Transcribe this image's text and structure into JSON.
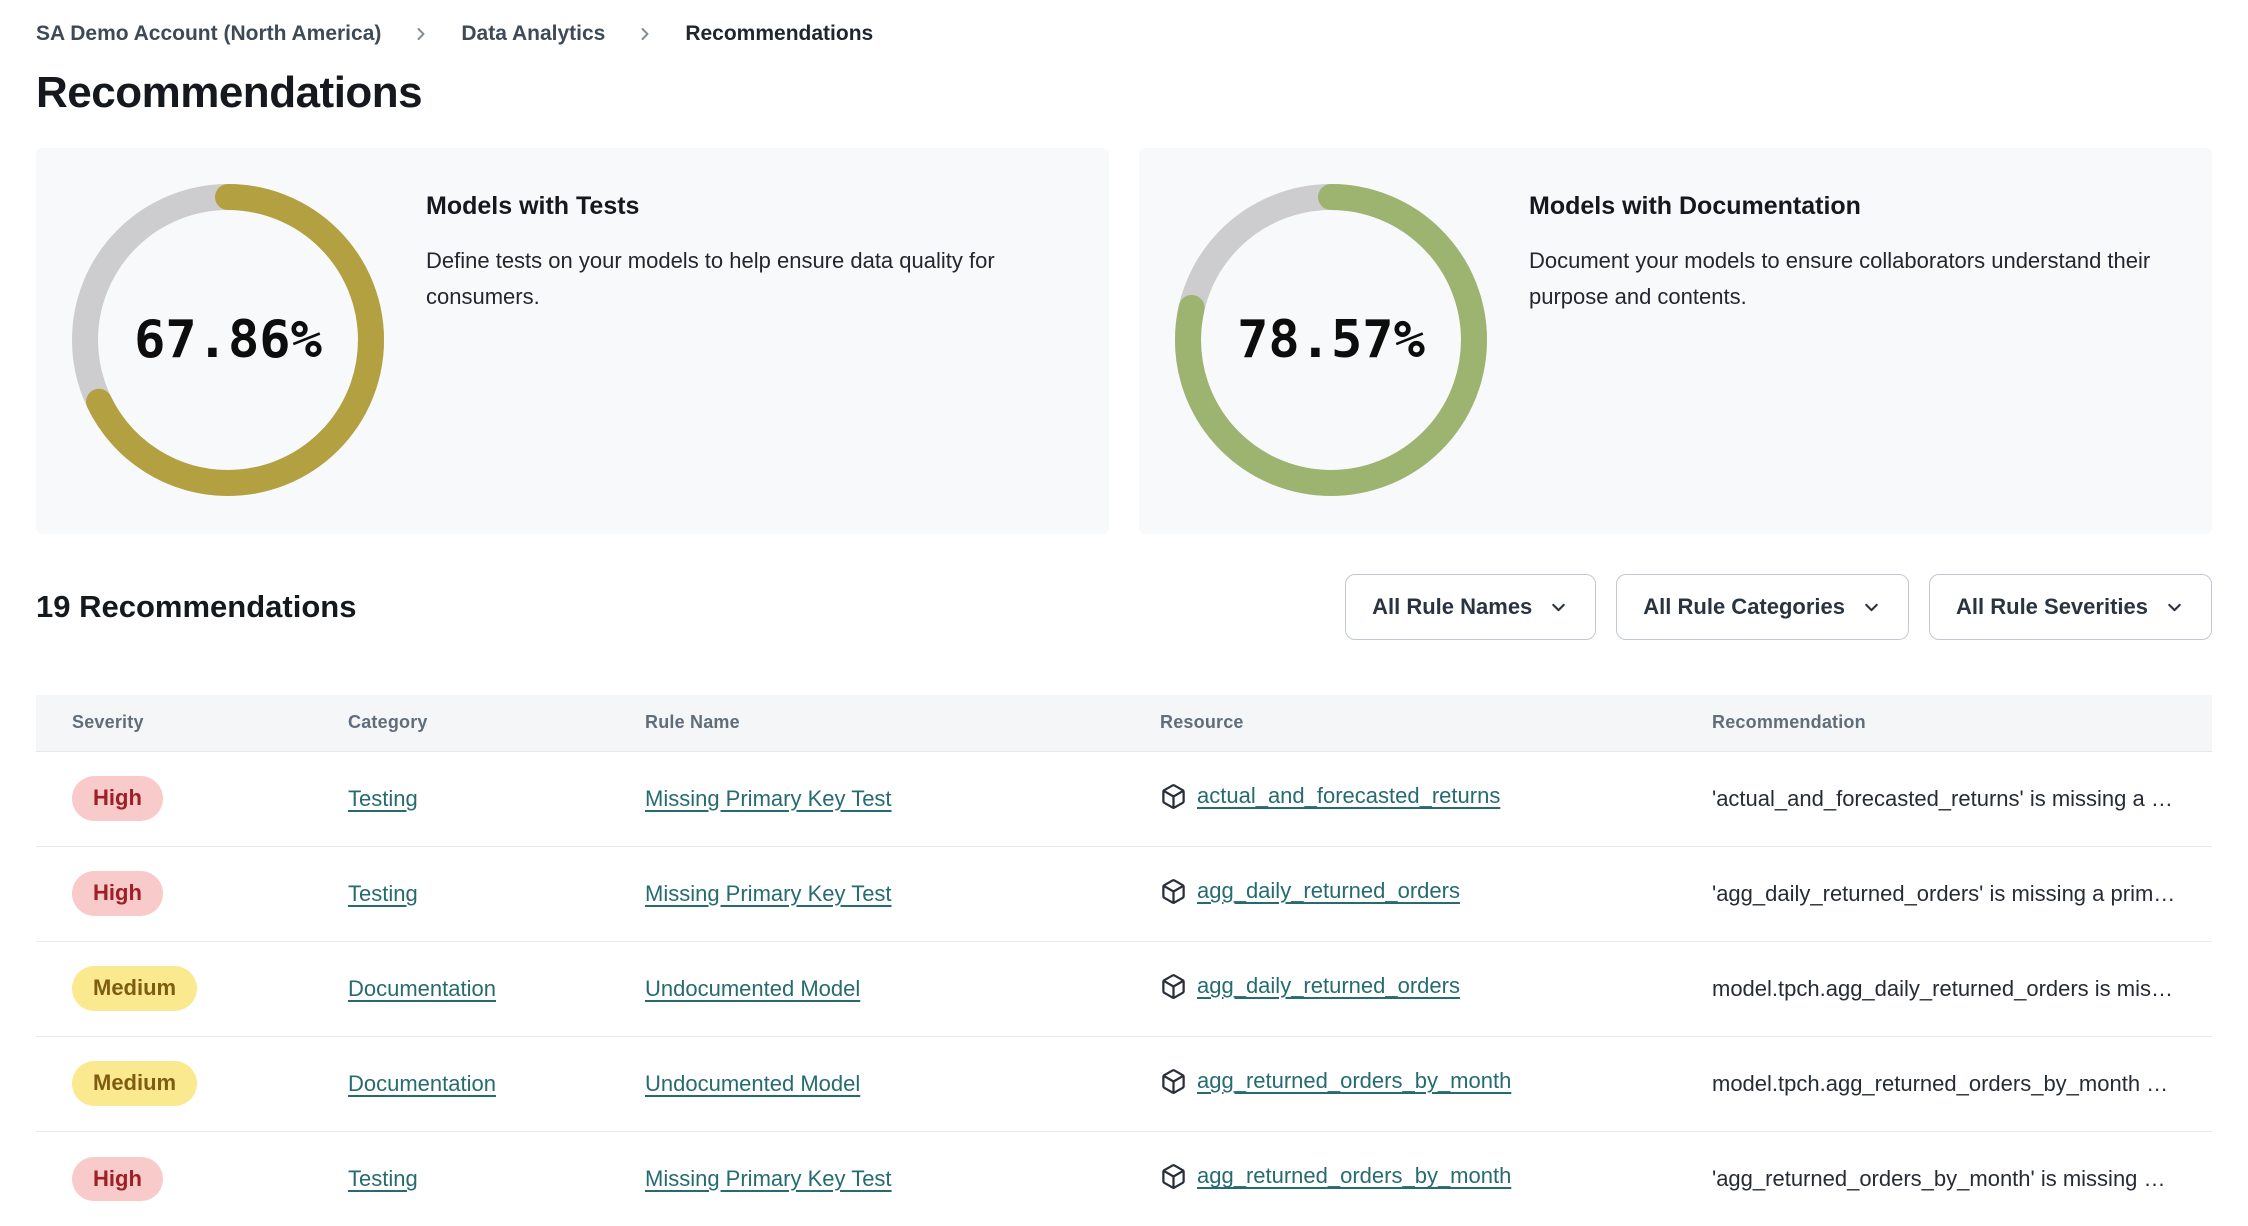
{
  "breadcrumb": {
    "items": [
      {
        "label": "SA Demo Account (North America)"
      },
      {
        "label": "Data Analytics"
      },
      {
        "label": "Recommendations"
      }
    ]
  },
  "page": {
    "title": "Recommendations"
  },
  "cards": [
    {
      "title": "Models with Tests",
      "description": "Define tests on your models to help ensure data quality for consumers.",
      "percent": 67.86,
      "percent_label": "67.86%",
      "arc_color": "#b3a041",
      "track_color": "#cdcdcf"
    },
    {
      "title": "Models with Documentation",
      "description": "Document your models to ensure collaborators understand their purpose and contents.",
      "percent": 78.57,
      "percent_label": "78.57%",
      "arc_color": "#9db470",
      "track_color": "#cdcdcf"
    }
  ],
  "list_header": {
    "title": "19 Recommendations"
  },
  "filters": [
    {
      "label": "All Rule Names"
    },
    {
      "label": "All Rule Categories"
    },
    {
      "label": "All Rule Severities"
    }
  ],
  "table": {
    "columns": [
      "Severity",
      "Category",
      "Rule Name",
      "Resource",
      "Recommendation"
    ],
    "rows": [
      {
        "severity": "High",
        "category": "Testing",
        "rule_name": "Missing Primary Key Test",
        "resource": "actual_and_forecasted_returns",
        "recommendation": "'actual_and_forecasted_returns' is missing a …"
      },
      {
        "severity": "High",
        "category": "Testing",
        "rule_name": "Missing Primary Key Test",
        "resource": "agg_daily_returned_orders",
        "recommendation": "'agg_daily_returned_orders' is missing a prim…"
      },
      {
        "severity": "Medium",
        "category": "Documentation",
        "rule_name": "Undocumented Model",
        "resource": "agg_daily_returned_orders",
        "recommendation": "model.tpch.agg_daily_returned_orders is mis…"
      },
      {
        "severity": "Medium",
        "category": "Documentation",
        "rule_name": "Undocumented Model",
        "resource": "agg_returned_orders_by_month",
        "recommendation": "model.tpch.agg_returned_orders_by_month …"
      },
      {
        "severity": "High",
        "category": "Testing",
        "rule_name": "Missing Primary Key Test",
        "resource": "agg_returned_orders_by_month",
        "recommendation": "'agg_returned_orders_by_month' is missing …"
      }
    ]
  },
  "severity_styles": {
    "High": {
      "bg": "#f8caca",
      "fg": "#9e2025"
    },
    "Medium": {
      "bg": "#fae98e",
      "fg": "#7e5c11"
    }
  },
  "colors": {
    "link_teal": "#266b70",
    "card_background": "#f8f9fa",
    "table_header_background": "#f5f6f7"
  },
  "icons": {
    "breadcrumb_separator": "chevron-right-icon",
    "filter_dropdown": "chevron-down-icon",
    "resource": "cube-icon"
  }
}
